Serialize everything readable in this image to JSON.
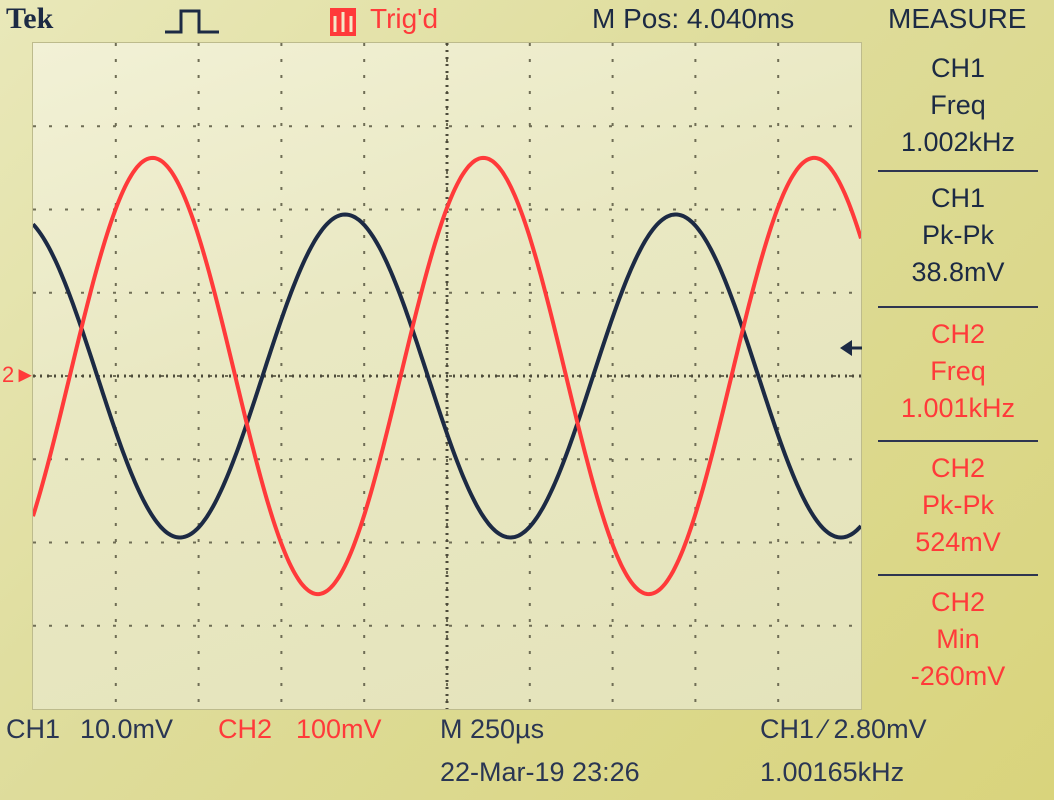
{
  "header": {
    "brand": "Tek",
    "pulse_icon": "single-pulse-icon",
    "trigger_status": "Trig'd",
    "horizontal_position": "M Pos: 4.040ms",
    "menu_title": "MEASURE"
  },
  "colors": {
    "ch1": "#1c2a44",
    "ch2": "#ff3a3a",
    "screen_bg": "#ecebc8"
  },
  "screen": {
    "ch2_marker": "2",
    "grid": {
      "divisions_x": 10,
      "divisions_y": 8
    }
  },
  "measurements": [
    {
      "channel": "CH1",
      "type": "Freq",
      "value": "1.002kHz"
    },
    {
      "channel": "CH1",
      "type": "Pk-Pk",
      "value": "38.8mV"
    },
    {
      "channel": "CH2",
      "type": "Freq",
      "value": "1.001kHz"
    },
    {
      "channel": "CH2",
      "type": "Pk-Pk",
      "value": "524mV"
    },
    {
      "channel": "CH2",
      "type": "Min",
      "value": "-260mV"
    }
  ],
  "status": {
    "ch1_label": "CH1",
    "ch1_scale": "10.0mV",
    "ch2_label": "CH2",
    "ch2_scale": "100mV",
    "timebase": "M 250µs",
    "trigger": "CH1 ∕ 2.80mV",
    "date": "22-Mar-19 23:26",
    "trigger_freq": "1.00165kHz"
  },
  "chart_data": {
    "type": "line",
    "series": [
      {
        "name": "CH1",
        "frequency_hz": 1002,
        "pk_pk_divisions": 3.88,
        "phase_deg": 110
      },
      {
        "name": "CH2",
        "frequency_hz": 1001,
        "pk_pk_divisions": 5.24,
        "phase_deg": -40,
        "center_divisions": 0
      }
    ],
    "x_range_ms": [
      0,
      2.5
    ],
    "grid": true
  }
}
